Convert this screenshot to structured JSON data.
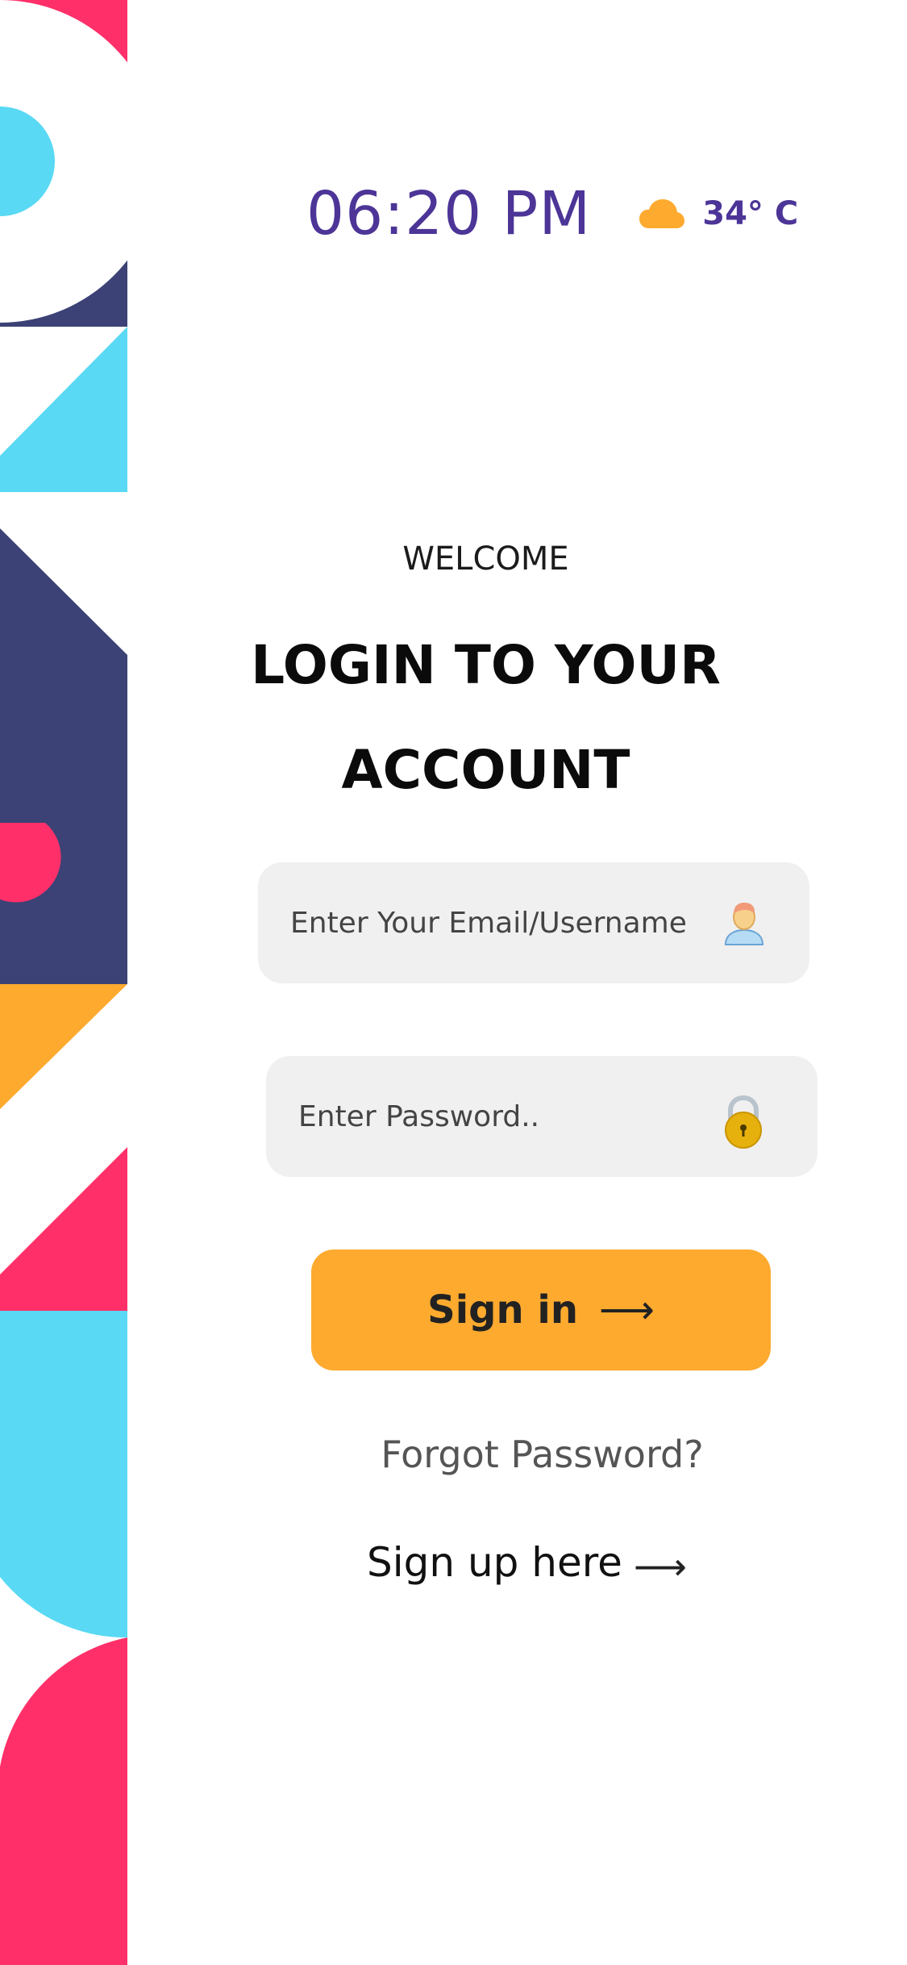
{
  "status": {
    "time": "06:20 PM",
    "weather_icon": "cloud-icon",
    "temperature": "34° C"
  },
  "header": {
    "welcome": "WELCOME",
    "title_line1": "LOGIN TO YOUR",
    "title_line2": "ACCOUNT"
  },
  "form": {
    "email_placeholder": "Enter Your Email/Username",
    "email_value": "",
    "email_icon": "user-avatar-icon",
    "password_placeholder": "Enter Password..",
    "password_value": "",
    "password_icon": "lock-icon"
  },
  "actions": {
    "signin_label": "Sign in",
    "signin_arrow": "⟶",
    "forgot_label": "Forgot Password?",
    "signup_label": "Sign up here",
    "signup_arrow": "⟶"
  },
  "colors": {
    "accent_purple": "#4c3597",
    "button_orange": "#fdaa2f",
    "deco_pink": "#ff3069",
    "deco_cyan": "#59d9f4",
    "deco_navy": "#3c4275",
    "input_bg": "#f0f0f0"
  }
}
